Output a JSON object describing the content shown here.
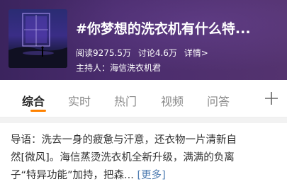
{
  "topic": {
    "title": "#你梦想的洗衣机有什么特...",
    "reads": "阅读9275.5万",
    "discussions": "讨论4.6万",
    "details": "详情>",
    "host": "主持人：海信洗衣机君"
  },
  "tabs": [
    {
      "label": "综合"
    },
    {
      "label": "实时"
    },
    {
      "label": "热门"
    },
    {
      "label": "视频"
    },
    {
      "label": "问答"
    }
  ],
  "intro": {
    "lines": [
      "导语：洗去一身的疲惫与汗意，还衣物一片清新自",
      "然[微风]。海信蒸烫洗衣机全新升级，满满的负离",
      "子“特异功能”加持，把森..."
    ],
    "more": "[更多]"
  },
  "colors": {
    "header_bg": "#4a2c6d",
    "accent": "#ff8200",
    "link": "#4e7cb1"
  },
  "icons": [
    "topic-cover-image",
    "plus-icon"
  ]
}
